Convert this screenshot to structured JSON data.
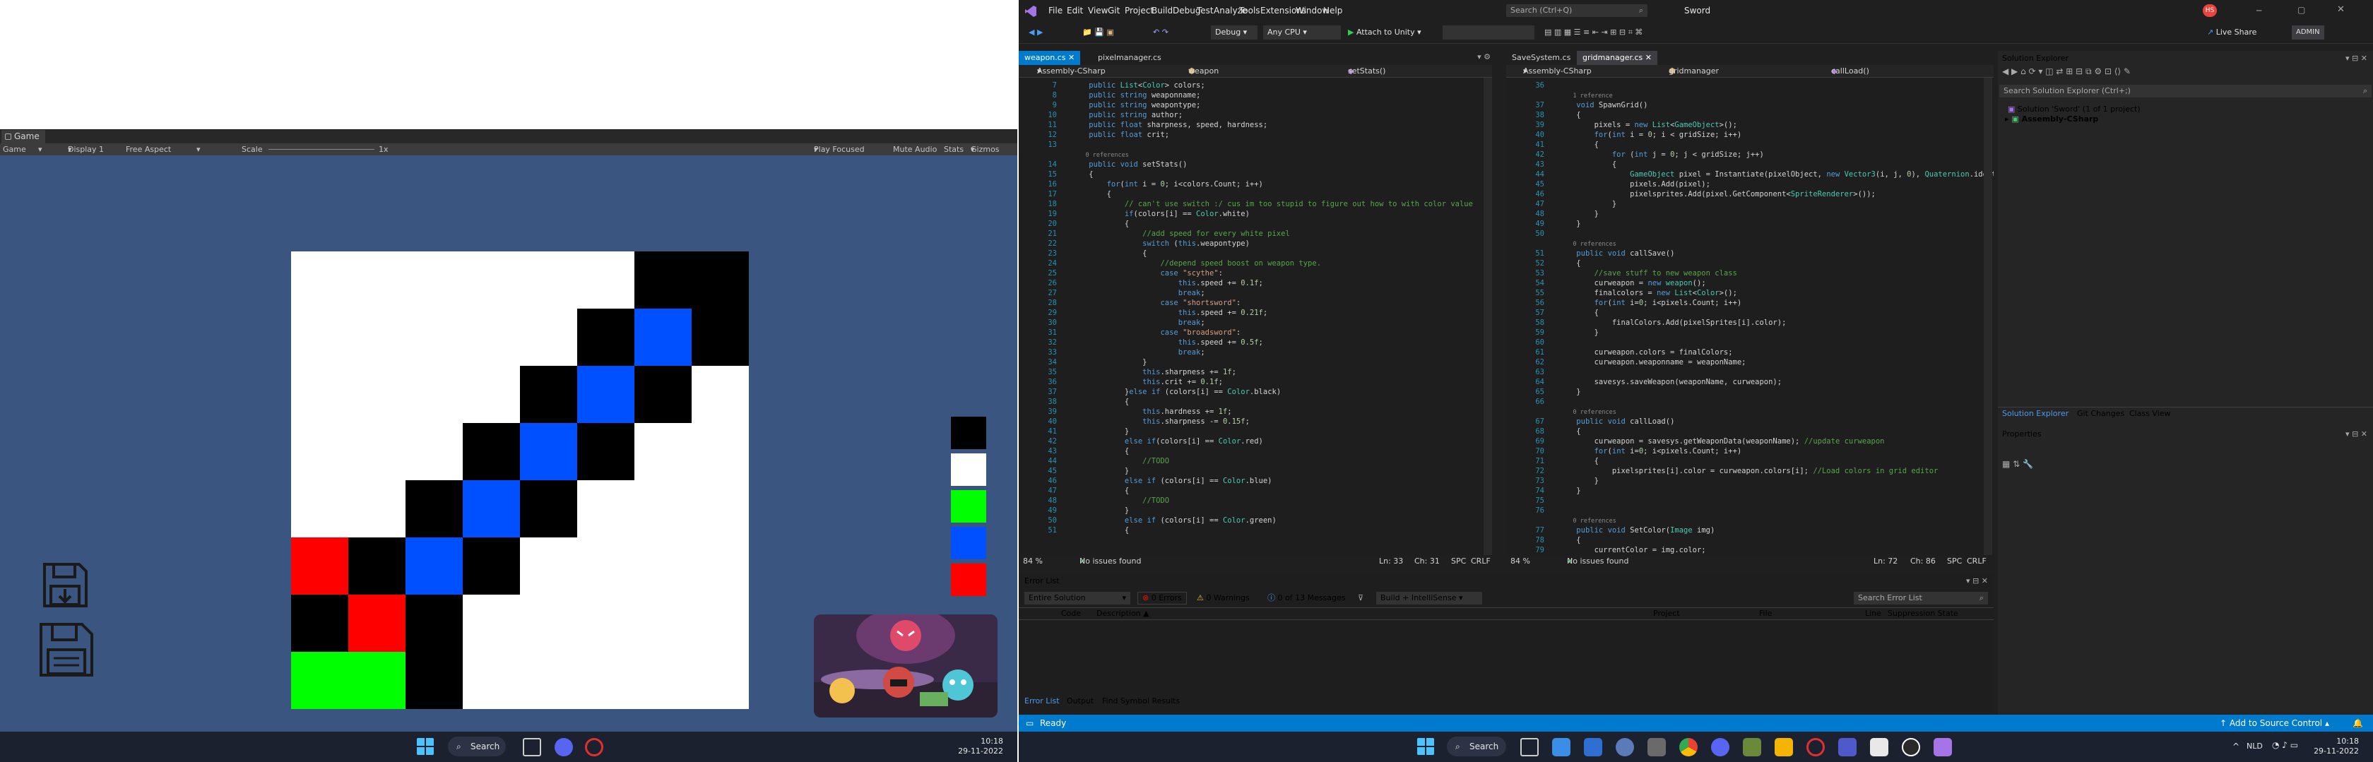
{
  "unity": {
    "tab_label": "Game",
    "toolbar": {
      "display_mode": "Game",
      "display": "Display 1",
      "aspect": "Free Aspect",
      "scale_label": "Scale",
      "scale_value": "1x",
      "play_focused": "Play Focused",
      "mute_audio": "Mute Audio",
      "stats": "Stats",
      "gizmos": "Gizmos"
    },
    "palette_colors": [
      "#000000",
      "#ffffff",
      "#00ff00",
      "#0050ff",
      "#ff0000"
    ],
    "grid_colors": {
      "white": "#ffffff",
      "black": "#000000",
      "blue": "#0050ff",
      "red": "#ff0000",
      "green": "#00ff00"
    }
  },
  "taskbar_left": {
    "search_label": "Search",
    "time": "10:18",
    "date": "29-11-2022"
  },
  "vs": {
    "menu": [
      "File",
      "Edit",
      "View",
      "Git",
      "Project",
      "Build",
      "Debug",
      "Test",
      "Analyze",
      "Tools",
      "Extensions",
      "Window",
      "Help"
    ],
    "search_placeholder": "Search (Ctrl+Q)",
    "solution_title": "Sword",
    "avatar_initials": "HS",
    "live_share": "Live Share",
    "admin": "ADMIN",
    "config": "Debug",
    "platform": "Any CPU",
    "attach": "Attach to Unity",
    "left_tabs": [
      "weapon.cs",
      "pixelmanager.cs"
    ],
    "left_nav": {
      "project": "Assembly-CSharp",
      "class": "weapon",
      "member": "setStats()"
    },
    "right_tabs": [
      "SaveSystem.cs",
      "gridmanager.cs"
    ],
    "right_nav": {
      "project": "Assembly-CSharp",
      "class": "gridmanager",
      "member": "callLoad()"
    },
    "left_status": {
      "zoom": "84 %",
      "issues": "No issues found",
      "ln": "Ln: 33",
      "ch": "Ch: 31",
      "spc": "SPC",
      "crlf": "CRLF"
    },
    "right_status": {
      "zoom": "84 %",
      "issues": "No issues found",
      "ln": "Ln: 72",
      "ch": "Ch: 86",
      "spc": "SPC",
      "crlf": "CRLF"
    },
    "error_list": {
      "title": "Error List",
      "scope": "Entire Solution",
      "errors": "0 Errors",
      "warnings": "0 Warnings",
      "messages": "0 of 13 Messages",
      "build": "Build + IntelliSense",
      "search": "Search Error List",
      "columns": [
        "Code",
        "Description",
        "Project",
        "File",
        "Line",
        "Suppression State"
      ],
      "bottom_tabs": [
        "Error List",
        "Output",
        "Find Symbol Results"
      ]
    },
    "solution_explorer": {
      "title": "Solution Explorer",
      "search": "Search Solution Explorer (Ctrl+;)",
      "solution": "Solution 'Sword' (1 of 1 project)",
      "project": "Assembly-CSharp",
      "tabs": [
        "Solution Explorer",
        "Git Changes",
        "Class View"
      ],
      "properties": "Properties"
    },
    "statusbar": {
      "ready": "Ready",
      "source_control": "Add to Source Control"
    },
    "left_code": [
      {
        "n": "7",
        "t": "    public List<Color> colors;"
      },
      {
        "n": "8",
        "t": "    public string weaponname;"
      },
      {
        "n": "9",
        "t": "    public string weapontype;"
      },
      {
        "n": "10",
        "t": "    public string author;"
      },
      {
        "n": "11",
        "t": "    public float sharpness, speed, hardness;"
      },
      {
        "n": "12",
        "t": "    public float crit;"
      },
      {
        "n": "13",
        "t": ""
      },
      {
        "n": "",
        "t": "    0 references"
      },
      {
        "n": "14",
        "t": "    public void setStats()"
      },
      {
        "n": "15",
        "t": "    {"
      },
      {
        "n": "16",
        "t": "        for(int i = 0; i<colors.Count; i++)"
      },
      {
        "n": "17",
        "t": "        {"
      },
      {
        "n": "18",
        "t": "            // can't use switch :/ cus im too stupid to figure out how to with color value"
      },
      {
        "n": "19",
        "t": "            if(colors[i] == Color.white)"
      },
      {
        "n": "20",
        "t": "            {"
      },
      {
        "n": "21",
        "t": "                //add speed for every white pixel"
      },
      {
        "n": "22",
        "t": "                switch (this.weapontype)"
      },
      {
        "n": "23",
        "t": "                {"
      },
      {
        "n": "24",
        "t": "                    //depend speed boost on weapon type."
      },
      {
        "n": "25",
        "t": "                    case \"scythe\":"
      },
      {
        "n": "26",
        "t": "                        this.speed += 0.1f;"
      },
      {
        "n": "27",
        "t": "                        break;"
      },
      {
        "n": "28",
        "t": "                    case \"shortsword\":"
      },
      {
        "n": "29",
        "t": "                        this.speed += 0.21f;"
      },
      {
        "n": "30",
        "t": "                        break;"
      },
      {
        "n": "31",
        "t": "                    case \"broadsword\":"
      },
      {
        "n": "32",
        "t": "                        this.speed += 0.5f;"
      },
      {
        "n": "33",
        "t": "                        break;"
      },
      {
        "n": "34",
        "t": "                }"
      },
      {
        "n": "35",
        "t": "                this.sharpness += 1f;"
      },
      {
        "n": "36",
        "t": "                this.crit += 0.1f;"
      },
      {
        "n": "37",
        "t": "            }else if (colors[i] == Color.black)"
      },
      {
        "n": "38",
        "t": "            {"
      },
      {
        "n": "39",
        "t": "                this.hardness += 1f;"
      },
      {
        "n": "40",
        "t": "                this.sharpness -= 0.15f;"
      },
      {
        "n": "41",
        "t": "            }"
      },
      {
        "n": "42",
        "t": "            else if(colors[i] == Color.red)"
      },
      {
        "n": "43",
        "t": "            {"
      },
      {
        "n": "44",
        "t": "                //TODO"
      },
      {
        "n": "45",
        "t": "            }"
      },
      {
        "n": "46",
        "t": "            else if (colors[i] == Color.blue)"
      },
      {
        "n": "47",
        "t": "            {"
      },
      {
        "n": "48",
        "t": "                //TODO"
      },
      {
        "n": "49",
        "t": "            }"
      },
      {
        "n": "50",
        "t": "            else if (colors[i] == Color.green)"
      },
      {
        "n": "51",
        "t": "            {"
      }
    ],
    "right_code": [
      {
        "n": "36",
        "t": ""
      },
      {
        "n": "",
        "t": "    1 reference"
      },
      {
        "n": "37",
        "t": "    void SpawnGrid()"
      },
      {
        "n": "38",
        "t": "    {"
      },
      {
        "n": "39",
        "t": "        pixels = new List<GameObject>();"
      },
      {
        "n": "40",
        "t": "        for(int i = 0; i < gridSize; i++)"
      },
      {
        "n": "41",
        "t": "        {"
      },
      {
        "n": "42",
        "t": "            for (int j = 0; j < gridSize; j++)"
      },
      {
        "n": "43",
        "t": "            {"
      },
      {
        "n": "44",
        "t": "                GameObject pixel = Instantiate(pixelObject, new Vector3(i, j, 0), Quaternion.identi"
      },
      {
        "n": "45",
        "t": "                pixels.Add(pixel);"
      },
      {
        "n": "46",
        "t": "                pixelsprites.Add(pixel.GetComponent<SpriteRenderer>());"
      },
      {
        "n": "47",
        "t": "            }"
      },
      {
        "n": "48",
        "t": "        }"
      },
      {
        "n": "49",
        "t": "    }"
      },
      {
        "n": "50",
        "t": ""
      },
      {
        "n": "",
        "t": "    0 references"
      },
      {
        "n": "51",
        "t": "    public void callSave()"
      },
      {
        "n": "52",
        "t": "    {"
      },
      {
        "n": "53",
        "t": "        //save stuff to new weapon class"
      },
      {
        "n": "54",
        "t": "        curweapon = new weapon();"
      },
      {
        "n": "55",
        "t": "        finalcolors = new List<Color>();"
      },
      {
        "n": "56",
        "t": "        for(int i=0; i<pixels.Count; i++)"
      },
      {
        "n": "57",
        "t": "        {"
      },
      {
        "n": "58",
        "t": "            finalColors.Add(pixelSprites[i].color);"
      },
      {
        "n": "59",
        "t": "        }"
      },
      {
        "n": "60",
        "t": ""
      },
      {
        "n": "61",
        "t": "        curweapon.colors = finalColors;"
      },
      {
        "n": "62",
        "t": "        curweapon.weaponname = weaponName;"
      },
      {
        "n": "63",
        "t": ""
      },
      {
        "n": "64",
        "t": "        savesys.saveWeapon(weaponName, curweapon);"
      },
      {
        "n": "65",
        "t": "    }"
      },
      {
        "n": "66",
        "t": ""
      },
      {
        "n": "",
        "t": "    0 references"
      },
      {
        "n": "67",
        "t": "    public void callLoad()"
      },
      {
        "n": "68",
        "t": "    {"
      },
      {
        "n": "69",
        "t": "        curweapon = savesys.getWeaponData(weaponName); //update curweapon"
      },
      {
        "n": "70",
        "t": "        for(int i=0; i<pixels.Count; i++)"
      },
      {
        "n": "71",
        "t": "        {"
      },
      {
        "n": "72",
        "t": "            pixelsprites[i].color = curweapon.colors[i]; //Load colors in grid editor"
      },
      {
        "n": "73",
        "t": "        }"
      },
      {
        "n": "74",
        "t": "    }"
      },
      {
        "n": "75",
        "t": ""
      },
      {
        "n": "76",
        "t": ""
      },
      {
        "n": "",
        "t": "    0 references"
      },
      {
        "n": "77",
        "t": "    public void SetColor(Image img)"
      },
      {
        "n": "78",
        "t": "    {"
      },
      {
        "n": "79",
        "t": "        currentColor = img.color;"
      }
    ]
  },
  "taskbar_right": {
    "search_label": "Search",
    "lang": "NLD",
    "time": "10:18",
    "date": "29-11-2022"
  }
}
